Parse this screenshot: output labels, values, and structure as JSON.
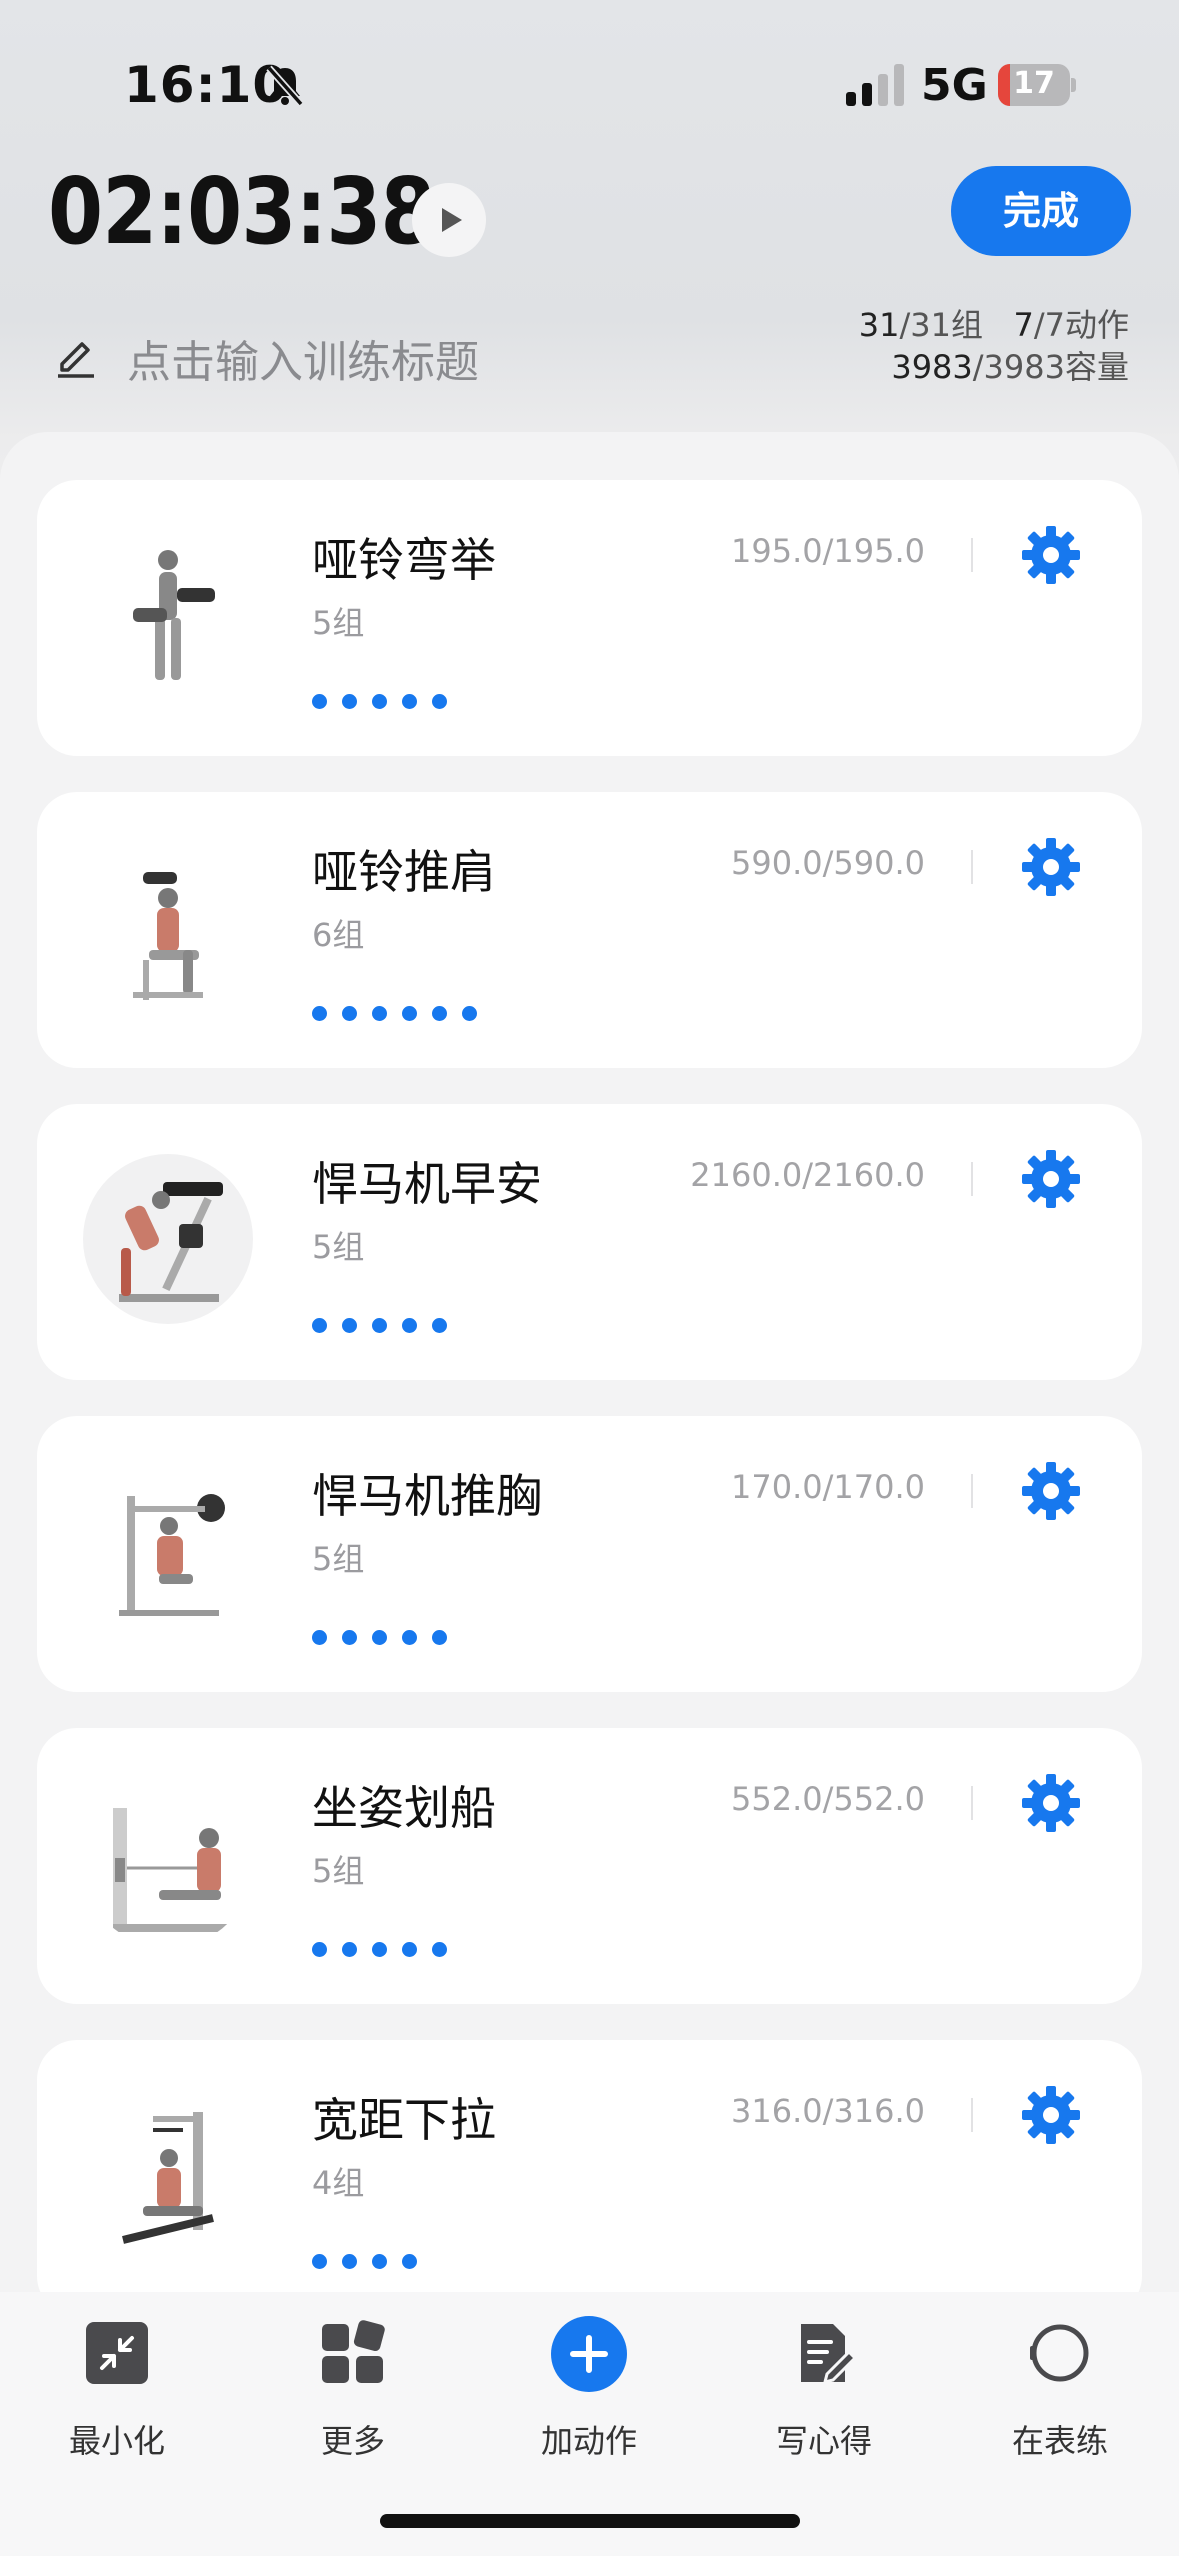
{
  "status_bar": {
    "time": "16:10",
    "network": "5G",
    "battery": "17",
    "battery_level_percent": 17
  },
  "header": {
    "timer": "02:03:38",
    "done_label": "完成",
    "title_placeholder": "点击输入训练标题",
    "stats": {
      "sets_done": "31",
      "sets_total": "/31",
      "sets_unit": "组",
      "actions_done": "7",
      "actions_total": "/7",
      "actions_unit": "动作",
      "volume_done": "3983",
      "volume_total": "/3983",
      "volume_unit": "容量"
    }
  },
  "exercises": [
    {
      "name": "哑铃弯举",
      "sets": "5组",
      "set_count": 5,
      "volume": "195.0/195.0"
    },
    {
      "name": "哑铃推肩",
      "sets": "6组",
      "set_count": 6,
      "volume": "590.0/590.0"
    },
    {
      "name": "悍马机早安",
      "sets": "5组",
      "set_count": 5,
      "volume": "2160.0/2160.0"
    },
    {
      "name": "悍马机推胸",
      "sets": "5组",
      "set_count": 5,
      "volume": "170.0/170.0"
    },
    {
      "name": "坐姿划船",
      "sets": "5组",
      "set_count": 5,
      "volume": "552.0/552.0"
    },
    {
      "name": "宽距下拉",
      "sets": "4组",
      "set_count": 4,
      "volume": "316.0/316.0"
    }
  ],
  "tabbar": {
    "minimize": "最小化",
    "more": "更多",
    "add": "加动作",
    "notes": "写心得",
    "watch": "在表练"
  },
  "colors": {
    "accent": "#1778ee",
    "battery_low": "#e5463c"
  },
  "icons": [
    "bell-slash-icon",
    "signal-icon",
    "battery-icon",
    "play-icon",
    "pencil-icon",
    "gear-icon",
    "minimize-icon",
    "grid-icon",
    "plus-icon",
    "document-edit-icon",
    "watch-icon"
  ]
}
